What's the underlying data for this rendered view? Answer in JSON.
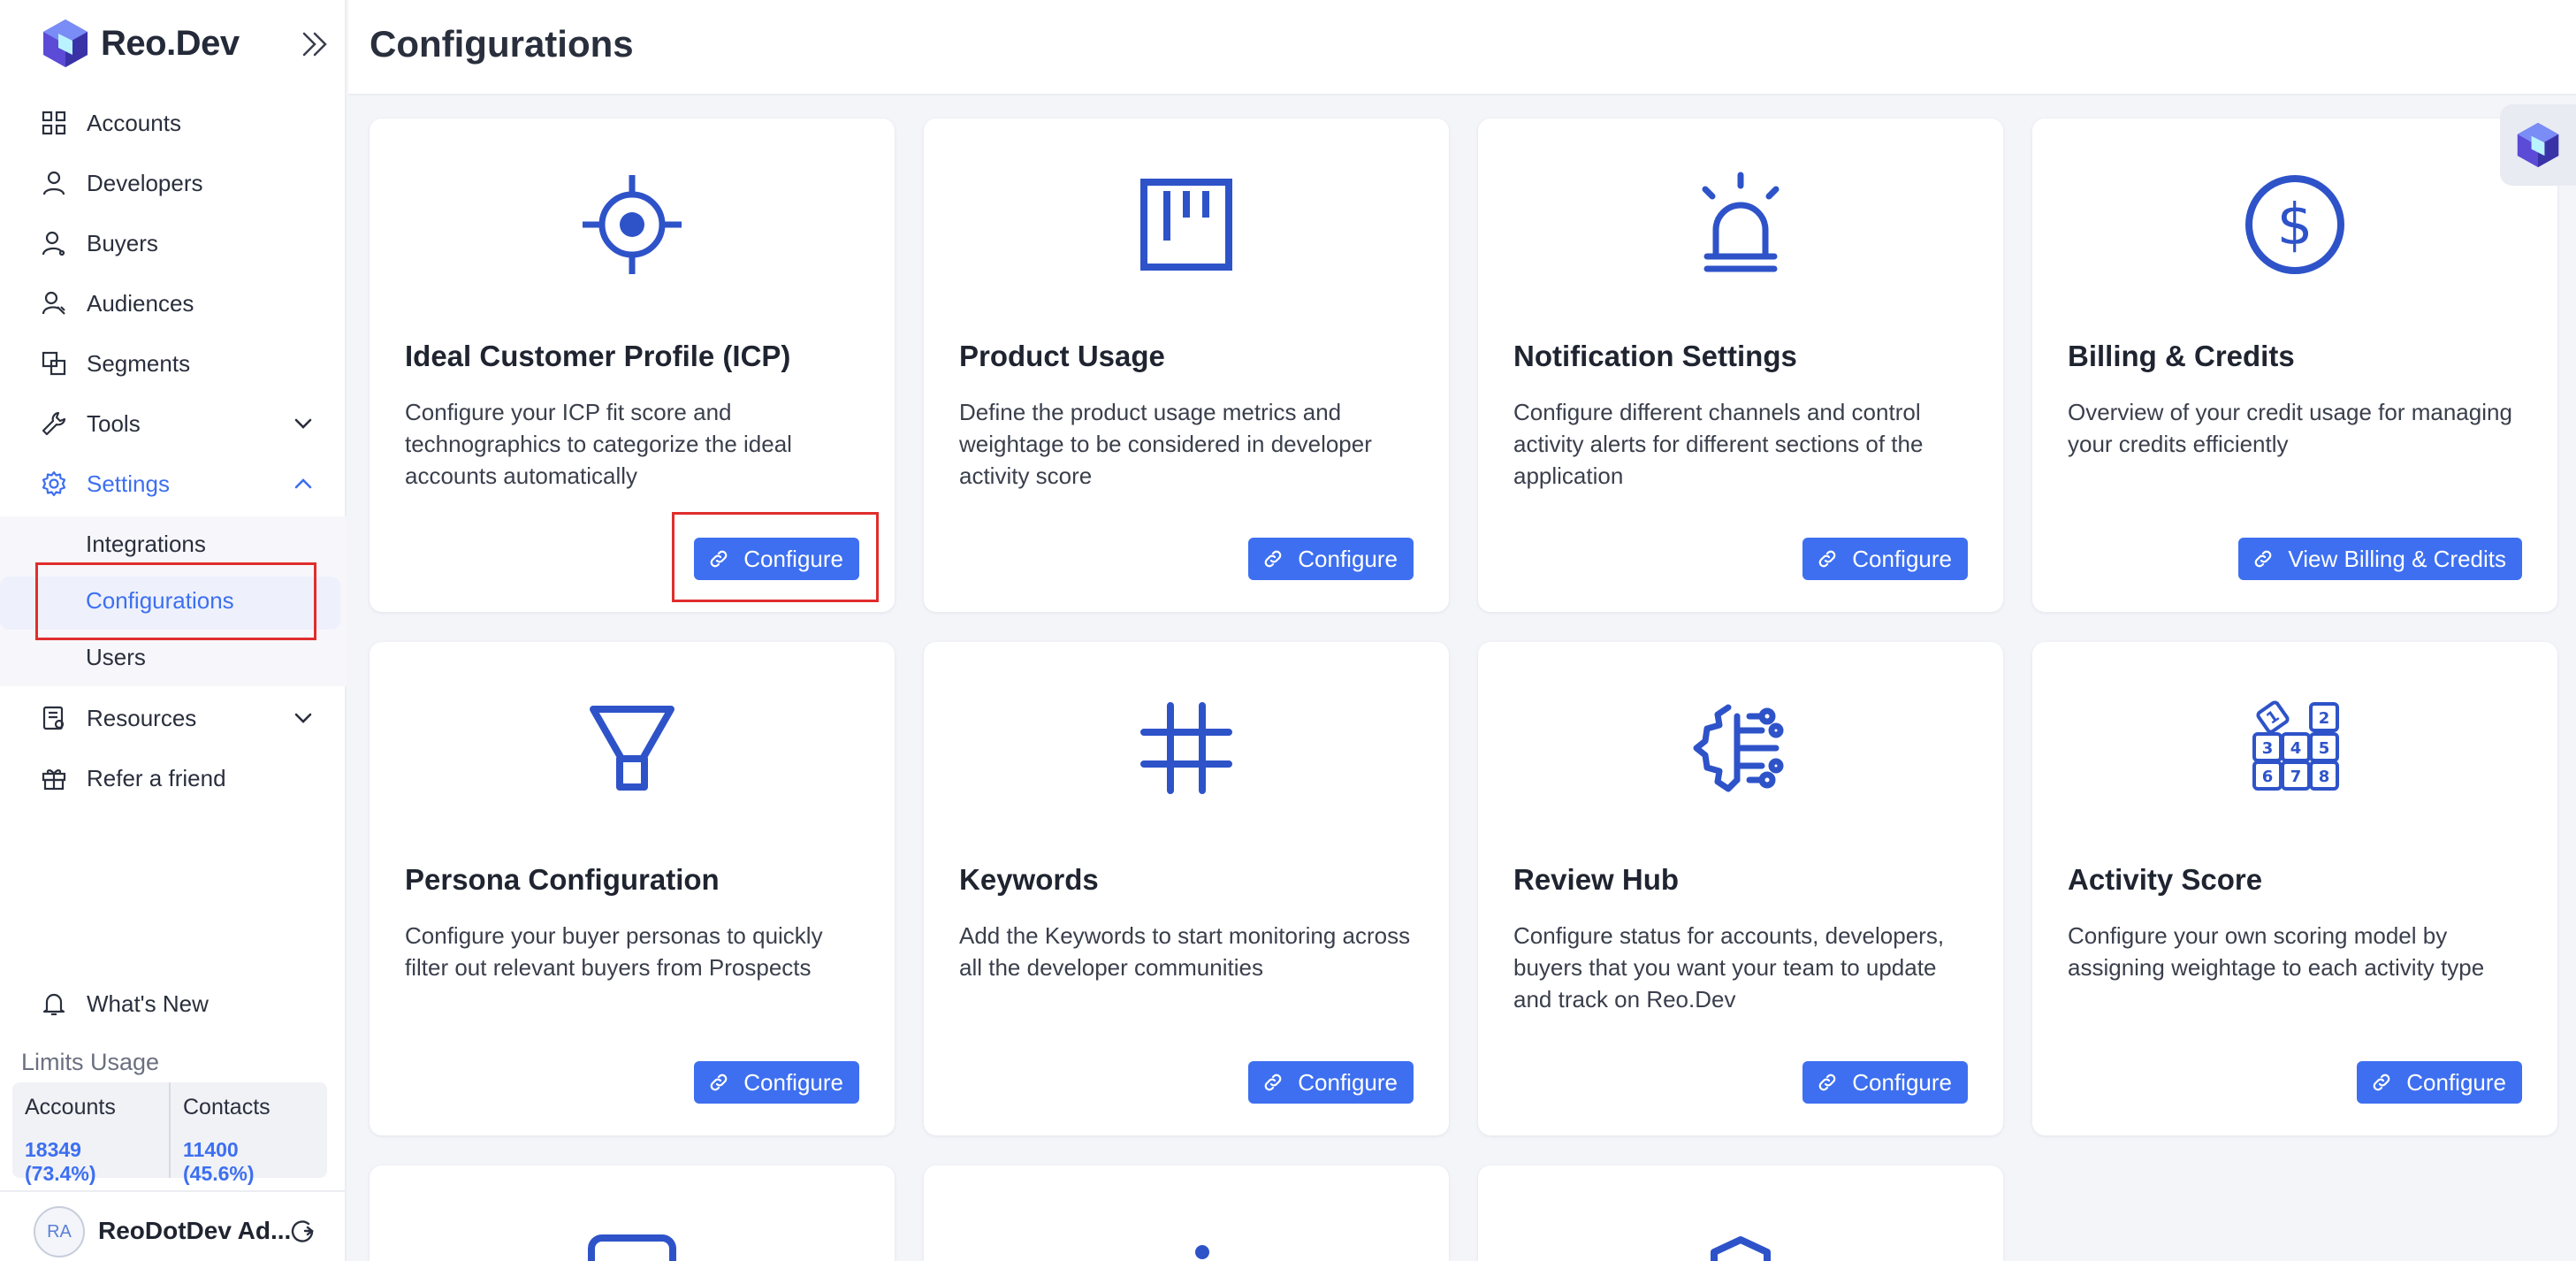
{
  "app": {
    "name": "Reo.Dev"
  },
  "page": {
    "title": "Configurations"
  },
  "sidebar": {
    "items": [
      {
        "label": "Accounts",
        "icon": "grid-icon"
      },
      {
        "label": "Developers",
        "icon": "user-icon"
      },
      {
        "label": "Buyers",
        "icon": "buyer-icon"
      },
      {
        "label": "Audiences",
        "icon": "audience-icon"
      },
      {
        "label": "Segments",
        "icon": "segments-icon"
      },
      {
        "label": "Tools",
        "icon": "wrench-icon"
      },
      {
        "label": "Settings",
        "icon": "gear-icon"
      }
    ],
    "submenu": [
      {
        "label": "Integrations"
      },
      {
        "label": "Configurations"
      },
      {
        "label": "Users"
      }
    ],
    "items2": [
      {
        "label": "Resources",
        "icon": "resources-icon"
      },
      {
        "label": "Refer a friend",
        "icon": "gift-icon"
      }
    ],
    "whats_new": "What's New",
    "limits": {
      "title": "Limits Usage",
      "accounts_label": "Accounts",
      "accounts_value": "18349 (73.4%)",
      "contacts_label": "Contacts",
      "contacts_value": "11400 (45.6%)"
    },
    "user": {
      "initials": "RA",
      "name": "ReoDotDev Ad..."
    }
  },
  "cards": [
    {
      "title": "Ideal Customer Profile (ICP)",
      "desc": "Configure your ICP fit score and technographics to categorize the ideal accounts automatically",
      "button": "Configure",
      "icon": "crosshair-icon"
    },
    {
      "title": "Product Usage",
      "desc": "Define the product usage metrics and weightage to be considered in developer activity score",
      "button": "Configure",
      "icon": "board-icon"
    },
    {
      "title": "Notification Settings",
      "desc": "Configure different channels and control activity alerts for different sections of the application",
      "button": "Configure",
      "icon": "alarm-icon"
    },
    {
      "title": "Billing & Credits",
      "desc": "Overview of your credit usage for managing your credits efficiently",
      "button": "View Billing & Credits",
      "icon": "dollar-icon"
    },
    {
      "title": "Persona Configuration",
      "desc": "Configure your buyer personas to quickly filter out relevant buyers from Prospects",
      "button": "Configure",
      "icon": "funnel-icon"
    },
    {
      "title": "Keywords",
      "desc": "Add the Keywords to start monitoring across all the developer communities",
      "button": "Configure",
      "icon": "hash-icon"
    },
    {
      "title": "Review Hub",
      "desc": "Configure status for accounts, developers, buyers that you want your team to update and track on Reo.Dev",
      "button": "Configure",
      "icon": "circuit-icon"
    },
    {
      "title": "Activity Score",
      "desc": "Configure your own scoring model by assigning weightage to each activity type",
      "button": "Configure",
      "icon": "number-blocks-icon"
    }
  ],
  "colors": {
    "accent": "#3d6ff0",
    "highlight": "#e02d2d",
    "icon": "#2e53c9"
  }
}
